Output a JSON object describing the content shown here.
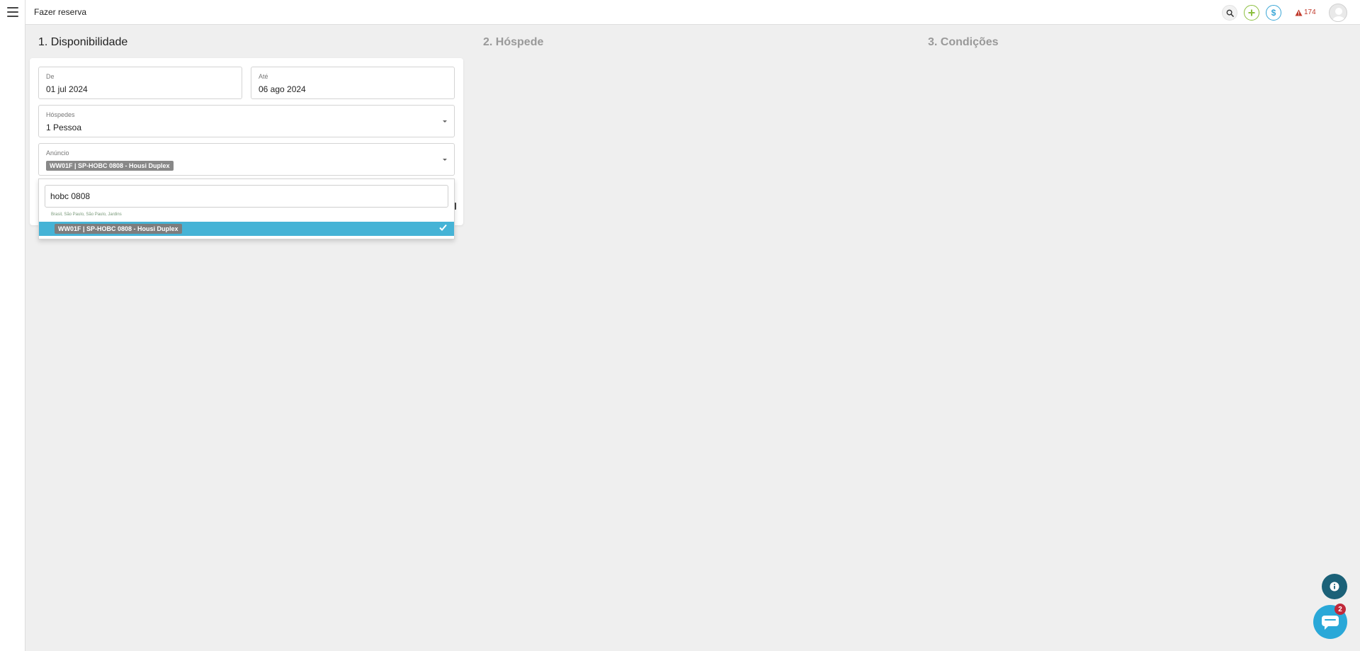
{
  "header": {
    "title": "Fazer reserva",
    "alert_count": "174"
  },
  "icons": {
    "menu": "hamburger-menu-icon",
    "search": "search-icon",
    "add": "plus-icon",
    "money": "dollar-icon",
    "alert": "warning-icon",
    "avatar": "user-avatar-icon",
    "info": "info-icon",
    "chat": "chat-icon",
    "check": "check-icon"
  },
  "colors": {
    "accent": "#45b3d6",
    "add_green": "#8cbf3f",
    "money_blue": "#3aa6d6",
    "alert_red": "#c0392b",
    "chat_badge": "#c0283a",
    "info_fab": "#1b6178"
  },
  "steps": {
    "step1": "1. Disponibilidade",
    "step2": "2. Hóspede",
    "step3": "3. Condições"
  },
  "form": {
    "from": {
      "label": "De",
      "value": "01 jul 2024"
    },
    "to": {
      "label": "Até",
      "value": "06 ago 2024"
    },
    "guests": {
      "label": "Hóspedes",
      "value": "1 Pessoa"
    },
    "listing": {
      "label": "Anúncio",
      "selected": "WW01F | SP-HOBC 0808 - Housi Duplex"
    }
  },
  "dropdown": {
    "search_value": "hobc 0808",
    "group_location": "Brasil, São Paulo, São Paulo, Jardins",
    "option_label": "WW01F | SP-HOBC 0808 - Housi Duplex"
  },
  "chat": {
    "badge": "2"
  }
}
